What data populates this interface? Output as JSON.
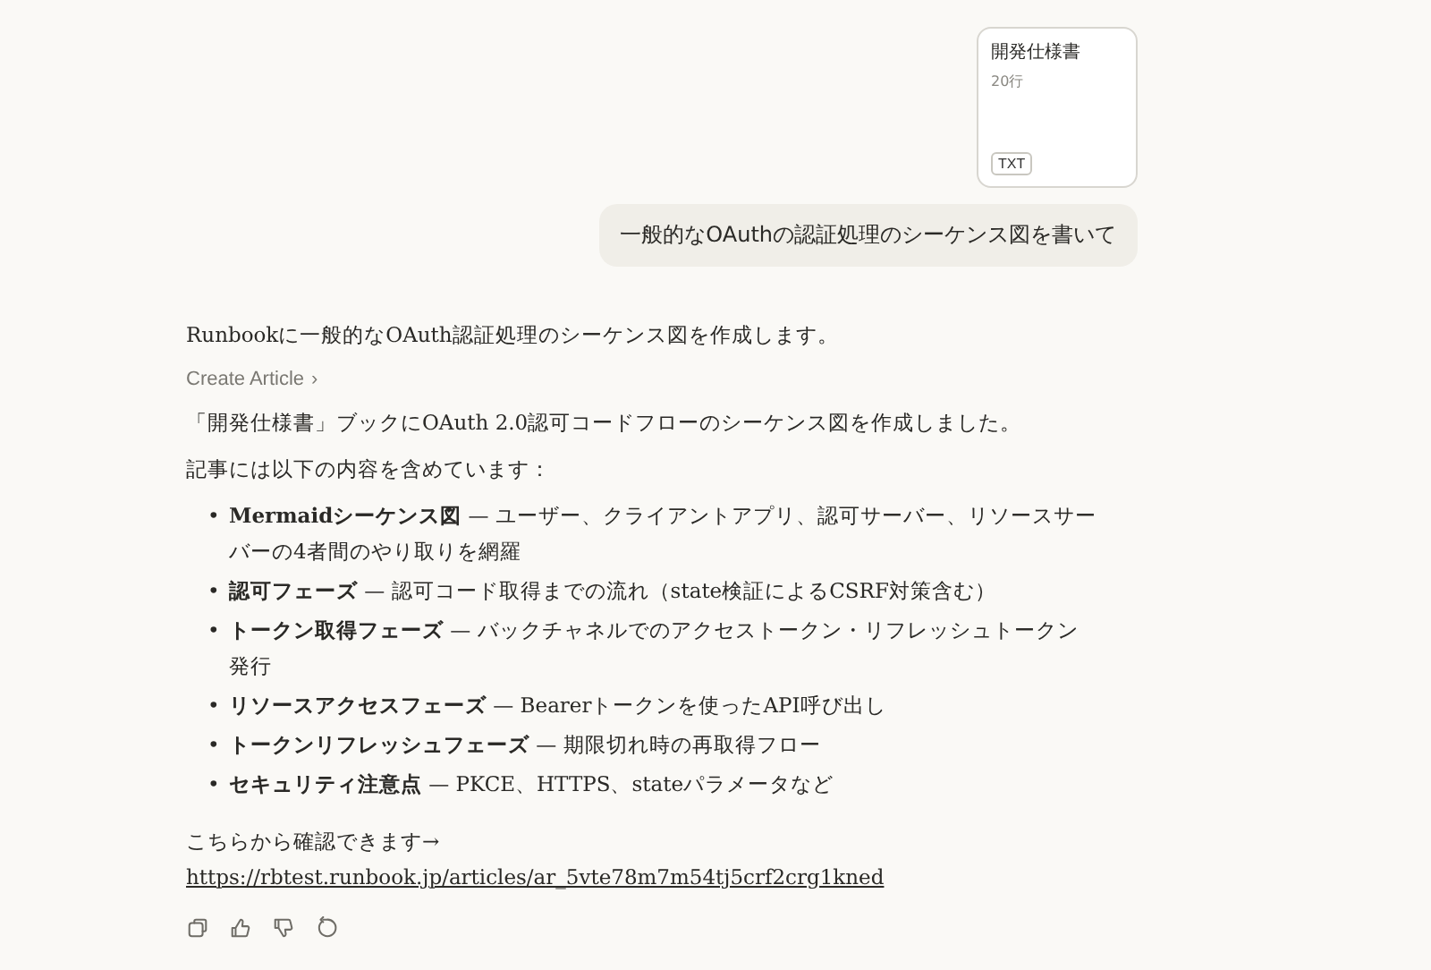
{
  "attachment": {
    "title": "開発仕様書",
    "meta": "20行",
    "type": "TXT"
  },
  "user_message": "一般的なOAuthの認証処理のシーケンス図を書いて",
  "assistant": {
    "intro": "Runbookに一般的なOAuth認証処理のシーケンス図を作成します。",
    "tool_call": {
      "label": "Create Article",
      "chevron": "›"
    },
    "paragraphs": [
      "「開発仕様書」ブックにOAuth 2.0認可コードフローのシーケンス図を作成しました。",
      "記事には以下の内容を含めています："
    ],
    "bullets": [
      {
        "marker": "•",
        "text": "**Mermaidシーケンス図** — ユーザー、クライアントアプリ、認可サーバー、リソースサーバーの4者間のやり取りを網羅"
      },
      {
        "marker": "•",
        "text": "**認可フェーズ** — 認可コード取得までの流れ（state検証によるCSRF対策含む）"
      },
      {
        "marker": "•",
        "text": "**トークン取得フェーズ** — バックチャネルでのアクセストークン・リフレッシュトークン発行"
      },
      {
        "marker": "•",
        "text": "**リソースアクセスフェーズ** — Bearerトークンを使ったAPI呼び出し"
      },
      {
        "marker": "•",
        "text": "**トークンリフレッシュフェーズ** — 期限切れ時の再取得フロー"
      },
      {
        "marker": "•",
        "text": "**セキュリティ注意点** — PKCE、HTTPS、stateパラメータなど"
      }
    ],
    "link_intro": "こちらから確認できます→",
    "link": "https://rbtest.runbook.jp/articles/ar_5vte78m7m54tj5crf2crg1kned",
    "actions": [
      {
        "kind": "copy"
      },
      {
        "kind": "thumbs-up"
      },
      {
        "kind": "thumbs-down"
      },
      {
        "kind": "retry"
      }
    ]
  }
}
